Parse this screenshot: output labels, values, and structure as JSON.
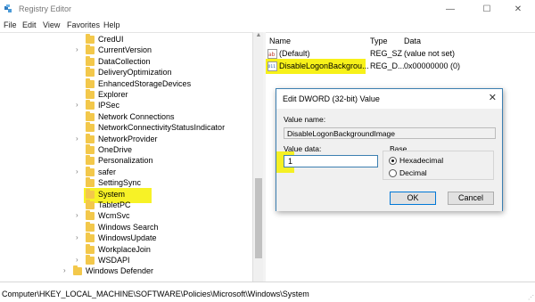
{
  "window": {
    "title": "Registry Editor",
    "controls": {
      "minimize": "—",
      "maximize": "☐",
      "close": "✕"
    }
  },
  "menu": [
    "File",
    "Edit",
    "View",
    "Favorites",
    "Help"
  ],
  "tree": {
    "items": [
      {
        "label": "CredUI",
        "expandable": false,
        "selected": false
      },
      {
        "label": "CurrentVersion",
        "expandable": true,
        "selected": false
      },
      {
        "label": "DataCollection",
        "expandable": false,
        "selected": false
      },
      {
        "label": "DeliveryOptimization",
        "expandable": false,
        "selected": false
      },
      {
        "label": "EnhancedStorageDevices",
        "expandable": false,
        "selected": false
      },
      {
        "label": "Explorer",
        "expandable": false,
        "selected": false
      },
      {
        "label": "IPSec",
        "expandable": true,
        "selected": false
      },
      {
        "label": "Network Connections",
        "expandable": false,
        "selected": false
      },
      {
        "label": "NetworkConnectivityStatusIndicator",
        "expandable": false,
        "selected": false
      },
      {
        "label": "NetworkProvider",
        "expandable": true,
        "selected": false
      },
      {
        "label": "OneDrive",
        "expandable": false,
        "selected": false
      },
      {
        "label": "Personalization",
        "expandable": false,
        "selected": false
      },
      {
        "label": "safer",
        "expandable": true,
        "selected": false
      },
      {
        "label": "SettingSync",
        "expandable": false,
        "selected": false
      },
      {
        "label": "System",
        "expandable": false,
        "selected": true
      },
      {
        "label": "TabletPC",
        "expandable": false,
        "selected": false
      },
      {
        "label": "WcmSvc",
        "expandable": true,
        "selected": false
      },
      {
        "label": "Windows Search",
        "expandable": false,
        "selected": false
      },
      {
        "label": "WindowsUpdate",
        "expandable": true,
        "selected": false
      },
      {
        "label": "WorkplaceJoin",
        "expandable": false,
        "selected": false
      },
      {
        "label": "WSDAPI",
        "expandable": true,
        "selected": false
      },
      {
        "label": "Windows Defender",
        "expandable": true,
        "selected": false
      }
    ]
  },
  "values": {
    "headers": {
      "name": "Name",
      "type": "Type",
      "data": "Data"
    },
    "rows": [
      {
        "name": "(Default)",
        "type": "REG_SZ",
        "data": "(value not set)",
        "icon": "string-value-icon"
      },
      {
        "name": "DisableLogonBackgrou...",
        "type": "REG_D...",
        "data": "0x00000000 (0)",
        "icon": "binary-value-icon"
      }
    ]
  },
  "dialog": {
    "title": "Edit DWORD (32-bit) Value",
    "close": "✕",
    "value_name_label": "Value name:",
    "value_name": "DisableLogonBackgroundImage",
    "value_data_label": "Value data:",
    "value_data": "1",
    "base_label": "Base",
    "base_options": [
      {
        "label": "Hexadecimal",
        "selected": true
      },
      {
        "label": "Decimal",
        "selected": false
      }
    ],
    "ok_label": "OK",
    "cancel_label": "Cancel"
  },
  "status": {
    "path": "Computer\\HKEY_LOCAL_MACHINE\\SOFTWARE\\Policies\\Microsoft\\Windows\\System"
  },
  "colors": {
    "highlight": "#f6f000",
    "folder": "#f3c84b",
    "dialog_border": "#3c7fb1"
  }
}
